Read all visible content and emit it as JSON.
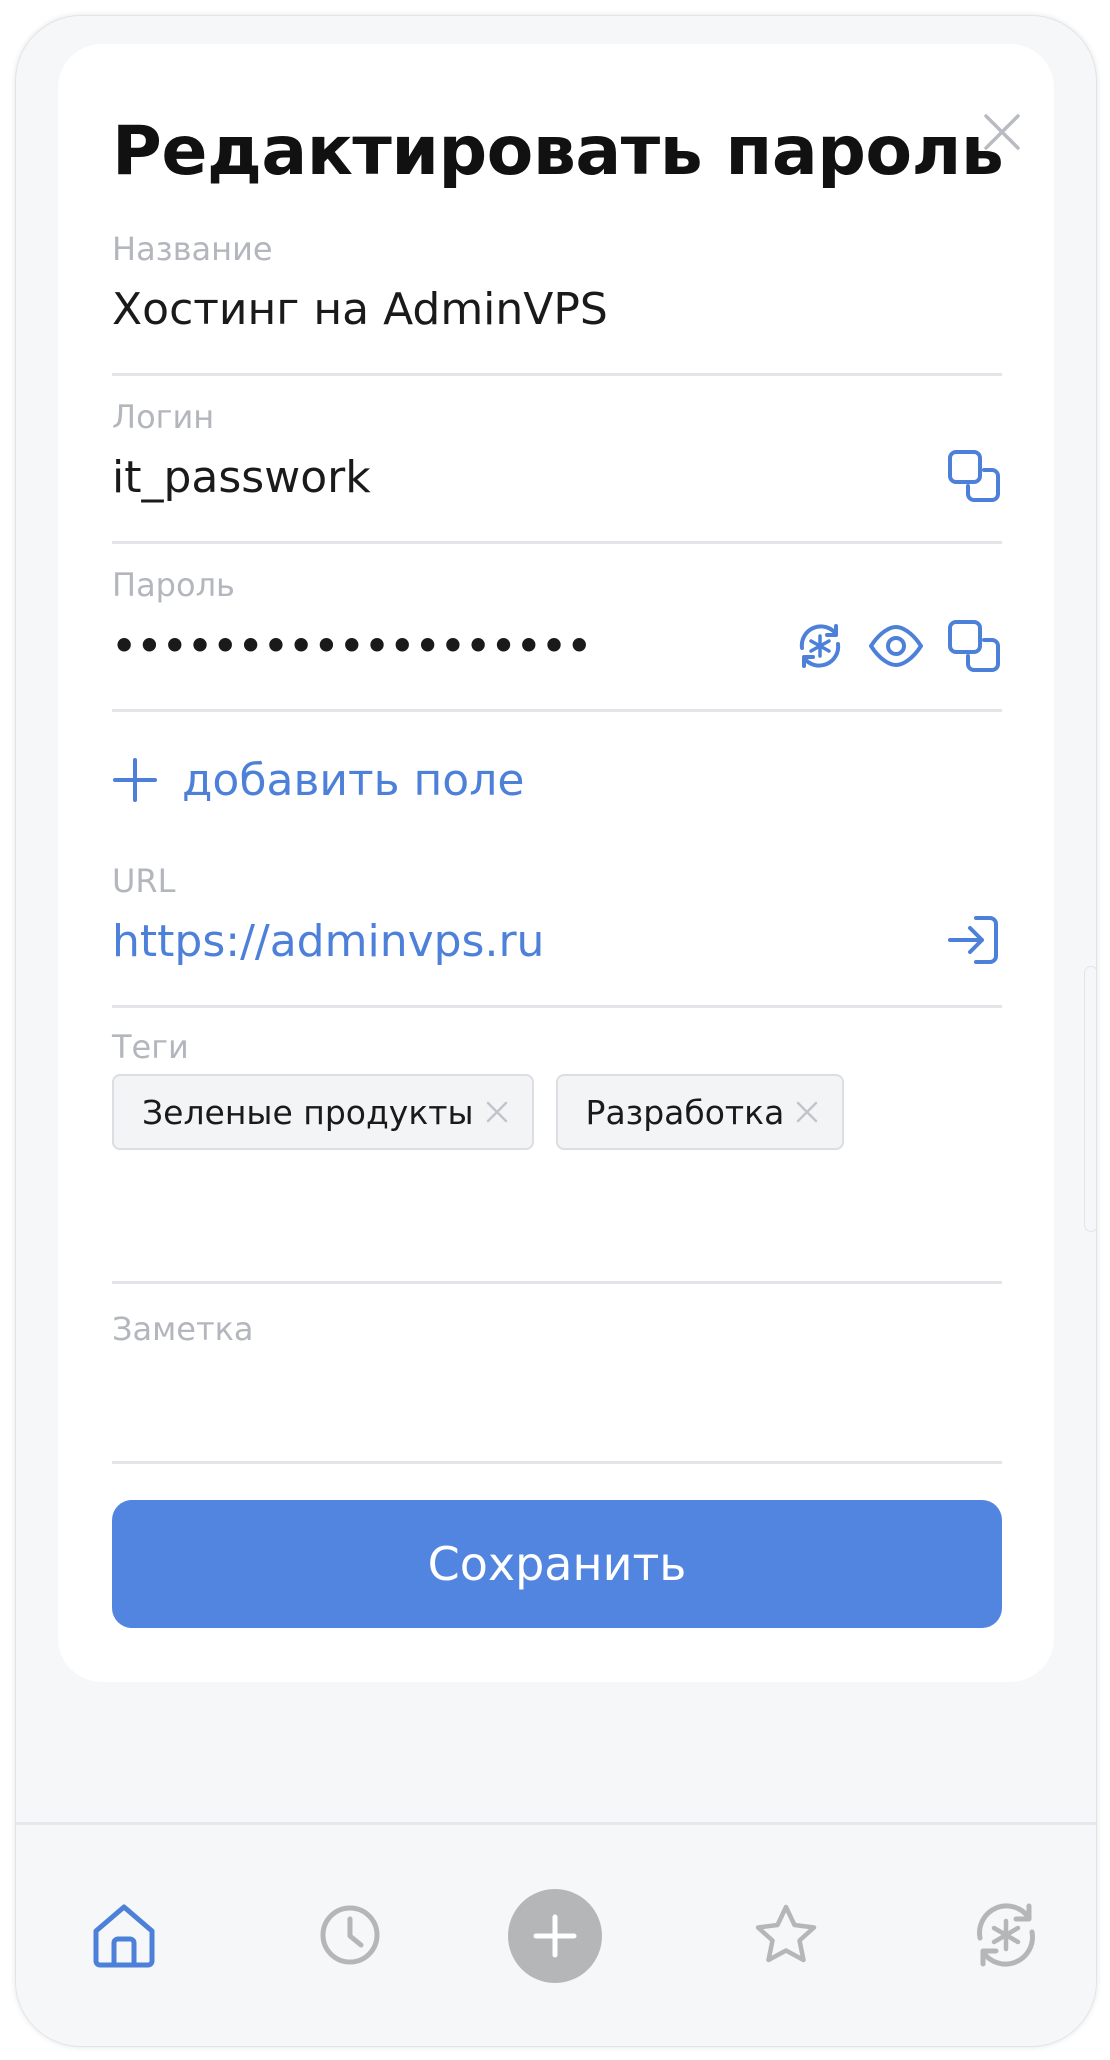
{
  "dialog": {
    "title": "Редактировать пароль"
  },
  "fields": {
    "name": {
      "label": "Название",
      "value": "Хостинг на AdminVPS"
    },
    "login": {
      "label": "Логин",
      "value": "it_passwork"
    },
    "password": {
      "label": "Пароль",
      "value": "•••••••••••••••••••"
    },
    "add_field_label": "добавить поле",
    "url": {
      "label": "URL",
      "value": "https://adminvps.ru"
    },
    "tags": {
      "label": "Теги",
      "items": [
        "Зеленые продукты",
        "Разработка"
      ]
    },
    "note": {
      "label": "Заметка",
      "value": ""
    }
  },
  "save_label": "Сохранить",
  "icons": {
    "close": "close-icon",
    "copy": "copy-icon",
    "generate": "generate-password-icon",
    "show": "eye-icon",
    "open_url": "open-link-icon",
    "add": "plus-icon",
    "tag_remove": "close-icon"
  },
  "bottom_nav": {
    "items": [
      "home-icon",
      "clock-icon",
      "plus-icon",
      "star-icon",
      "generator-icon"
    ],
    "active": "home-icon"
  },
  "colors": {
    "accent": "#4d80d9",
    "button": "#5185e0",
    "label": "#b3b6bd",
    "nav_inactive": "#b5b6b8"
  }
}
